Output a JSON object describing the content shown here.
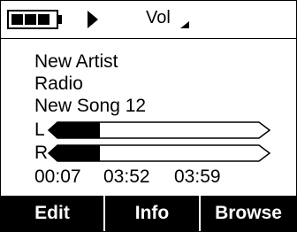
{
  "status": {
    "battery_icon": "battery-icon",
    "battery_level": 0.75,
    "play_icon": "play-icon",
    "volume_label": "Vol",
    "volume_icon": "volume-triangle-icon"
  },
  "track": {
    "artist": "New Artist",
    "album": "Radio",
    "title": "New Song 12"
  },
  "meters": {
    "left_label": "L",
    "right_label": "R",
    "left_level": 0.2,
    "right_level": 0.2
  },
  "times": {
    "elapsed": "00:07",
    "remaining": "03:52",
    "total": "03:59"
  },
  "soft_keys": {
    "edit": "Edit",
    "info": "Info",
    "browse": "Browse"
  }
}
